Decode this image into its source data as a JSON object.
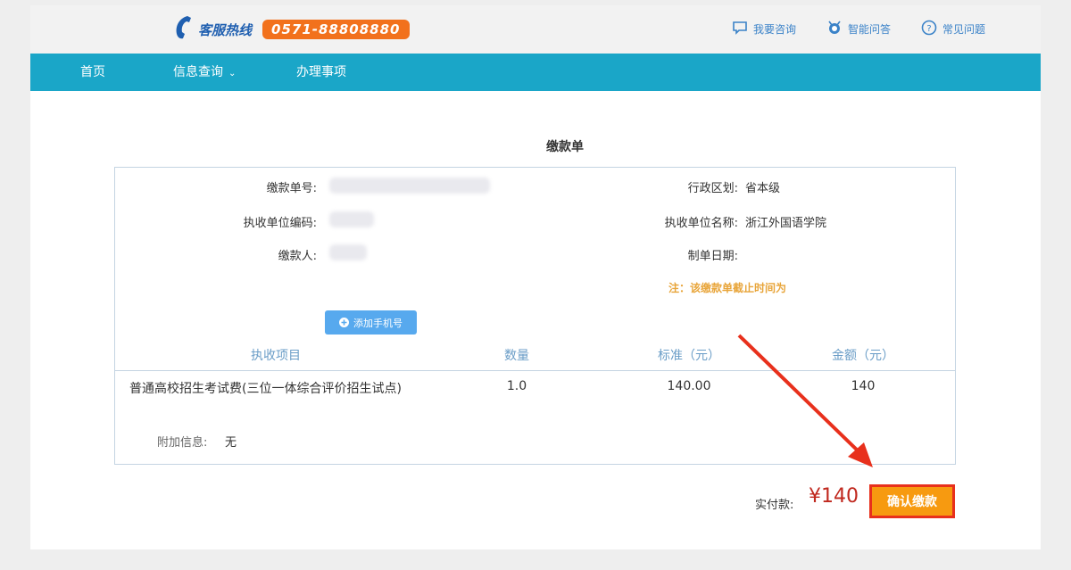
{
  "header": {
    "hotline_label": "客服热线",
    "hotline_number": "0571-88808880",
    "links": [
      {
        "label": "我要咨询",
        "icon": "chat-icon"
      },
      {
        "label": "智能问答",
        "icon": "robot-icon"
      },
      {
        "label": "常见问题",
        "icon": "question-icon"
      }
    ]
  },
  "nav": {
    "home": "首页",
    "info_query": "信息查询",
    "affairs": "办理事项"
  },
  "bill": {
    "title": "缴款单",
    "fields": {
      "bill_no_label": "缴款单号:",
      "region_label": "行政区划:",
      "region_value": "省本级",
      "unit_code_label": "执收单位编码:",
      "unit_name_label": "执收单位名称:",
      "unit_name_value": "浙江外国语学院",
      "payer_label": "缴款人:",
      "date_label": "制单日期:"
    },
    "note": "注：该缴款单截止时间为",
    "add_phone_label": "添加手机号",
    "table": {
      "headers": [
        "执收项目",
        "数量",
        "标准（元）",
        "金额（元）"
      ],
      "rows": [
        [
          "普通高校招生考试费(三位一体综合评价招生试点)",
          "1.0",
          "140.00",
          "140"
        ]
      ]
    },
    "extra_label": "附加信息:",
    "extra_value": "无"
  },
  "payment": {
    "paid_label": "实付款:",
    "amount": "¥140",
    "confirm_label": "确认缴款"
  },
  "colors": {
    "nav": "#1aa6c8",
    "hotline_badge": "#f2711c",
    "confirm": "#f79a10",
    "arrow": "#e8301c"
  }
}
